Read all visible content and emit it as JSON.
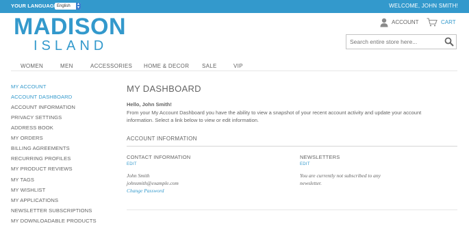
{
  "header": {
    "language_label": "YOUR LANGUAGE:",
    "language_selected": "English",
    "welcome": "WELCOME, JOHN SMITH!",
    "logo_line1": "MADISON",
    "logo_line2": "ISLAND",
    "account_label": "ACCOUNT",
    "cart_label": "CART",
    "search_placeholder": "Search entire store here..."
  },
  "nav": {
    "items": [
      "WOMEN",
      "MEN",
      "ACCESSORIES",
      "HOME & DECOR",
      "SALE",
      "VIP"
    ]
  },
  "sidebar": {
    "title": "MY ACCOUNT",
    "items": [
      "ACCOUNT DASHBOARD",
      "ACCOUNT INFORMATION",
      "PRIVACY SETTINGS",
      "ADDRESS BOOK",
      "MY ORDERS",
      "BILLING AGREEMENTS",
      "RECURRING PROFILES",
      "MY PRODUCT REVIEWS",
      "MY TAGS",
      "MY WISHLIST",
      "MY APPLICATIONS",
      "NEWSLETTER SUBSCRIPTIONS",
      "MY DOWNLOADABLE PRODUCTS"
    ]
  },
  "main": {
    "title": "MY DASHBOARD",
    "hello": "Hello, John Smith!",
    "intro": "From your My Account Dashboard you have the ability to view a snapshot of your recent account activity and update your account information. Select a link below to view or edit information.",
    "section_title": "ACCOUNT INFORMATION",
    "contact": {
      "title": "CONTACT INFORMATION",
      "edit": "EDIT",
      "name": "John Smith",
      "email": "johnsmith@example.com",
      "change_password": "Change Password"
    },
    "newsletters": {
      "title": "NEWSLETTERS",
      "edit": "EDIT",
      "line1": "You are currently not subscribed to any",
      "line2": "newsletter."
    }
  },
  "colors": {
    "accent": "#3399cc",
    "text": "#636363"
  },
  "icons": [
    "user-icon",
    "cart-icon",
    "search-icon",
    "select-arrows-icon"
  ]
}
